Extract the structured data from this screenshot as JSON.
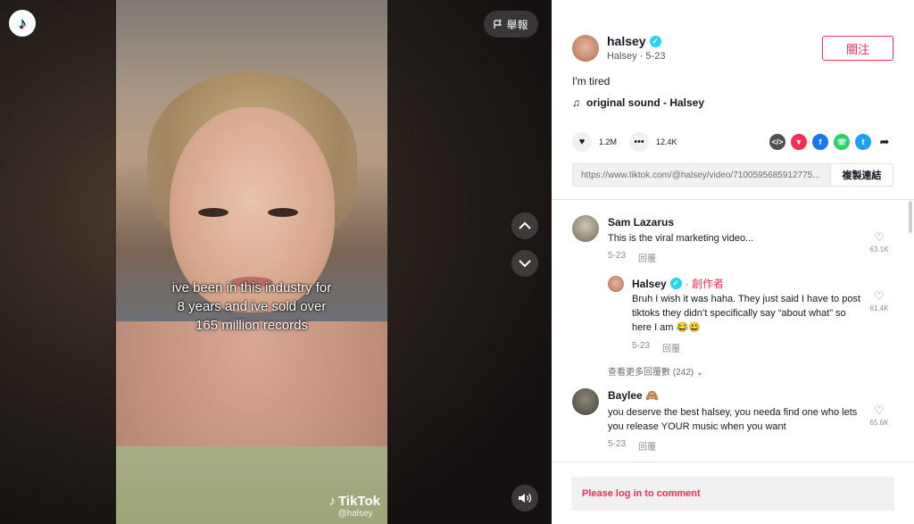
{
  "video": {
    "caption_lines": [
      "ive been in this industry for",
      "8 years and ive sold over",
      "165 million records"
    ],
    "watermark_brand": "TikTok",
    "watermark_user": "@halsey",
    "report_label": "舉報",
    "nav_up_icon": "chevron-up-icon",
    "nav_down_icon": "chevron-down-icon",
    "sound_icon": "speaker-icon"
  },
  "author": {
    "username": "halsey",
    "display_name": "Halsey",
    "date": "5-23",
    "follow_label": "關注"
  },
  "post": {
    "description": "I'm tired",
    "music": "original sound - Halsey",
    "likes": "1.2M",
    "comments": "12.4K",
    "share_icons": [
      "embed-icon",
      "send-icon",
      "facebook-icon",
      "whatsapp-icon",
      "twitter-icon",
      "share-arrow-icon"
    ],
    "link": "https://www.tiktok.com/@halsey/video/7100595685912775...",
    "copy_label": "複製連結"
  },
  "comments": [
    {
      "name": "Sam Lazarus",
      "text": "This is the viral marketing video...",
      "date": "5-23",
      "reply_label": "回覆",
      "likes": "63.1K"
    },
    {
      "name": "Halsey",
      "creator_label": "· 創作者",
      "text": "Bruh I wish it was haha. They just said I have to post tiktoks they didn’t specifically say “about what” so here I am 😂😃",
      "date": "5-23",
      "reply_label": "回覆",
      "likes": "61.4K"
    },
    {
      "name": "Baylee 🙈",
      "text": "you deserve the best halsey, you needa find one who lets you release YOUR music when you want",
      "date": "5-23",
      "reply_label": "回覆",
      "likes": "65.6K"
    }
  ],
  "more_replies": "查看更多回覆數 (242)",
  "login_prompt": "Please log in to comment"
}
